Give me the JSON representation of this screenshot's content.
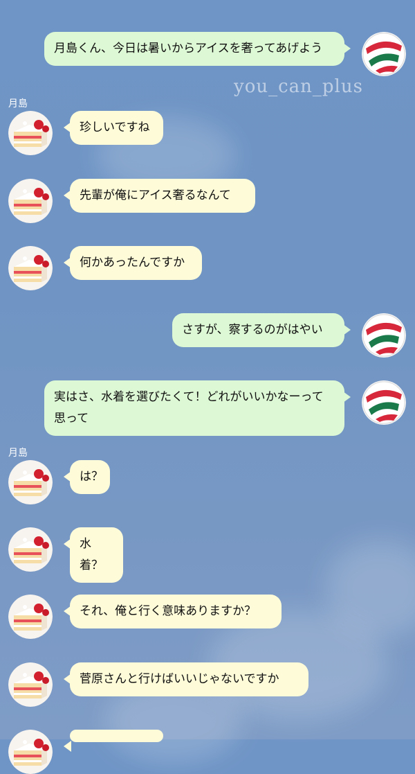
{
  "watermark": "you_can_plus",
  "sender_name": "月島",
  "icons": {
    "me_avatar": "volleyball-icon",
    "them_avatar": "strawberry-cake-icon"
  },
  "colors": {
    "mine_bubble": "#ddf8d4",
    "theirs_bubble": "#fefbd9",
    "background": "#7095c4"
  },
  "messages": [
    {
      "from": "me",
      "text": "月島くん、今日は暑いからアイスを奢ってあげよう"
    },
    {
      "from": "them",
      "text": "珍しいですね"
    },
    {
      "from": "them",
      "text": "先輩が俺にアイス奢るなんて"
    },
    {
      "from": "them",
      "text": "何かあったんですか"
    },
    {
      "from": "me",
      "text": "さすが、察するのがはやい"
    },
    {
      "from": "me",
      "text": "実はさ、水着を選びたくて！どれがいいかなーって思って"
    },
    {
      "from": "them",
      "text": "は？"
    },
    {
      "from": "them",
      "text": "水着？"
    },
    {
      "from": "them",
      "text": "それ、俺と行く意味ありますか？"
    },
    {
      "from": "them",
      "text": "菅原さんと行けばいいじゃないですか"
    },
    {
      "from": "them",
      "text": ""
    }
  ]
}
